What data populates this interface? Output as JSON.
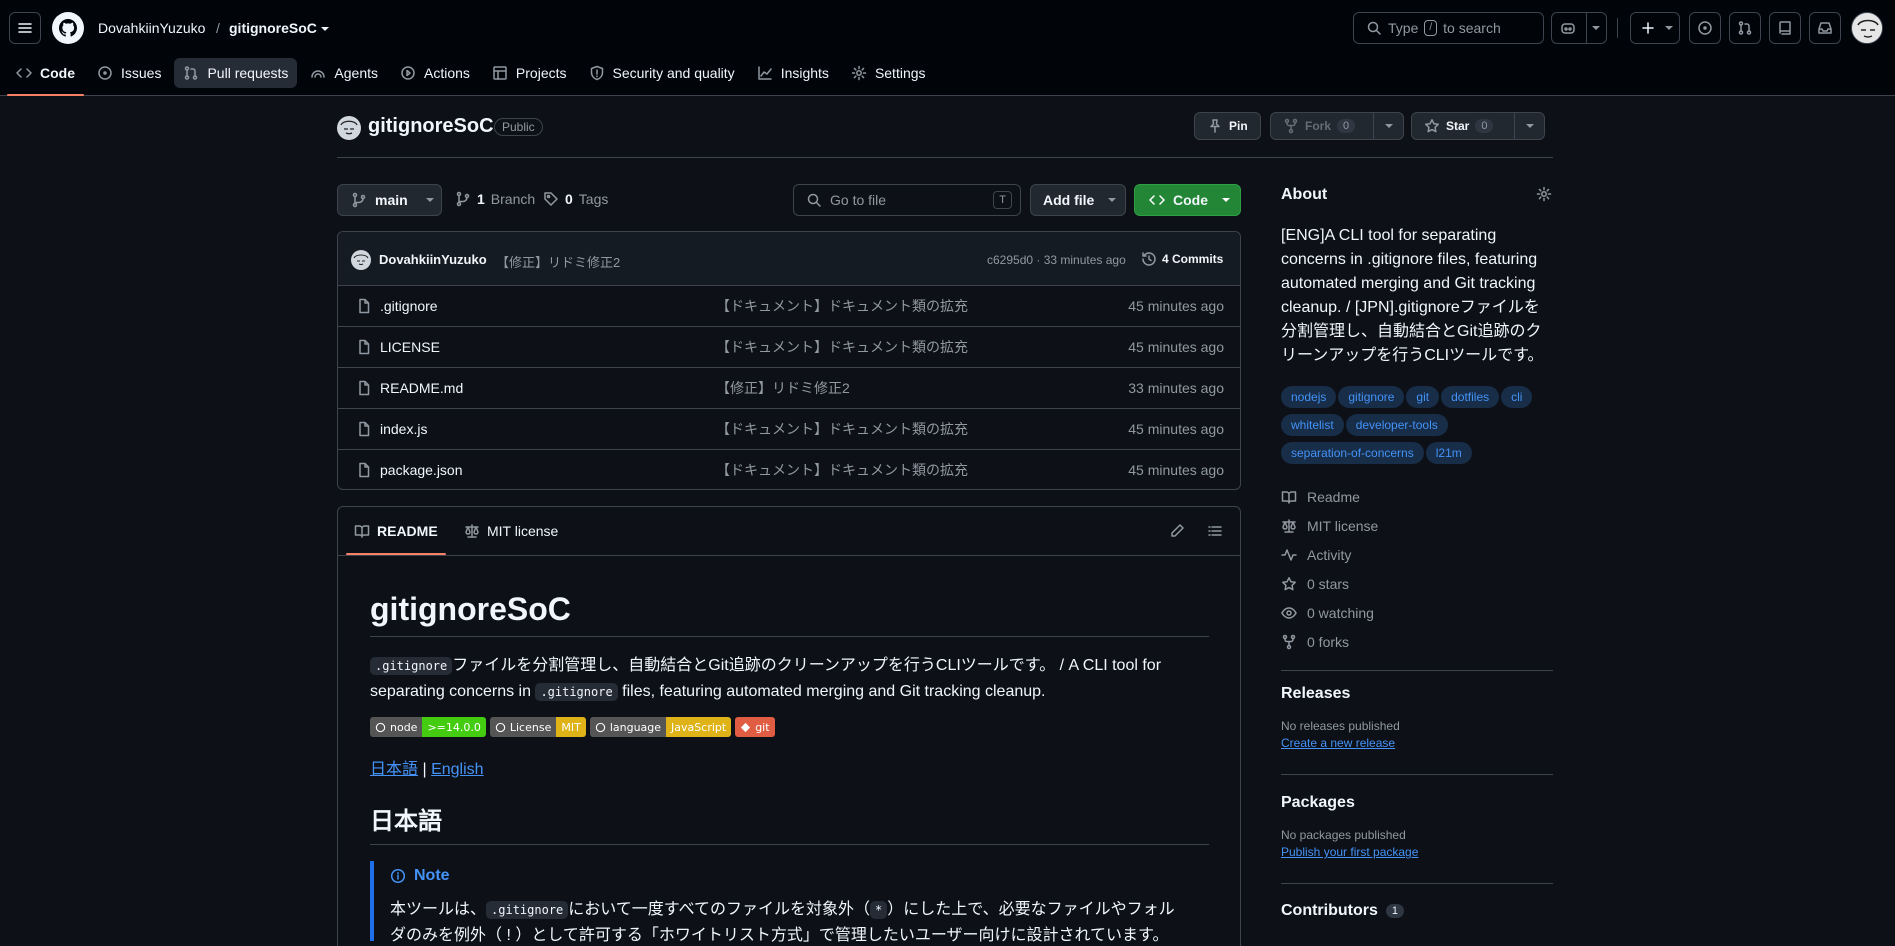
{
  "header": {
    "owner": "DovahkiinYuzuko",
    "separator": "/",
    "repo": "gitignoreSoC",
    "search_pre": "Type",
    "search_key": "/",
    "search_post": "to search"
  },
  "nav": [
    {
      "label": "Code",
      "icon": "code-icon"
    },
    {
      "label": "Issues",
      "icon": "issue-icon"
    },
    {
      "label": "Pull requests",
      "icon": "pull-request-icon"
    },
    {
      "label": "Agents",
      "icon": "agent-icon"
    },
    {
      "label": "Actions",
      "icon": "play-icon"
    },
    {
      "label": "Projects",
      "icon": "table-icon"
    },
    {
      "label": "Security and quality",
      "icon": "shield-icon"
    },
    {
      "label": "Insights",
      "icon": "graph-icon"
    },
    {
      "label": "Settings",
      "icon": "gear-icon"
    }
  ],
  "repo": {
    "name": "gitignoreSoC",
    "visibility": "Public",
    "pin": "Pin",
    "fork": "Fork",
    "fork_count": "0",
    "star": "Star",
    "star_count": "0"
  },
  "toolbar": {
    "branch": "main",
    "branches_count": "1",
    "branches_label": "Branch",
    "tags_count": "0",
    "tags_label": "Tags",
    "goto_placeholder": "Go to file",
    "goto_key": "T",
    "add_file": "Add file",
    "code": "Code"
  },
  "commit": {
    "author": "DovahkiinYuzuko",
    "message": "【修正】リドミ修正2",
    "meta": "c6295d0 · 33 minutes ago",
    "commits": "4 Commits"
  },
  "files": [
    {
      "name": ".gitignore",
      "message": "【ドキュメント】ドキュメント類の拡充",
      "age": "45 minutes ago"
    },
    {
      "name": "LICENSE",
      "message": "【ドキュメント】ドキュメント類の拡充",
      "age": "45 minutes ago"
    },
    {
      "name": "README.md",
      "message": "【修正】リドミ修正2",
      "age": "33 minutes ago"
    },
    {
      "name": "index.js",
      "message": "【ドキュメント】ドキュメント類の拡充",
      "age": "45 minutes ago"
    },
    {
      "name": "package.json",
      "message": "【ドキュメント】ドキュメント類の拡充",
      "age": "45 minutes ago"
    }
  ],
  "readme": {
    "tab_readme": "README",
    "tab_license": "MIT license",
    "title": "gitignoreSoC",
    "code_gitignore": ".gitignore",
    "para_jp": "ファイルを分割管理し、自動結合とGit追跡のクリーンアップを行うCLIツールです。 / A CLI tool for",
    "para_en_pre": "separating concerns in",
    "para_en_post": "files, featuring automated merging and Git tracking cleanup.",
    "badges": [
      {
        "left": "node",
        "right": ">=14.0.0",
        "color": "#4c1"
      },
      {
        "left": "License",
        "right": "MIT",
        "color": "#dfb317"
      },
      {
        "left": "language",
        "right": "JavaScript",
        "color": "#dfb317"
      },
      {
        "left": "",
        "right": "git",
        "color": "#e05d44"
      }
    ],
    "lang_jp": "日本語",
    "lang_sep": "|",
    "lang_en": "English",
    "h2": "日本語",
    "note_title": "Note",
    "note_pre": "本ツールは、",
    "note_mid": "において一度すべてのファイルを対象外（",
    "note_star": "*",
    "note_post": "）にした上で、必要なファイルやフォル",
    "note_line2": "ダのみを例外（ ! ）として許可する「ホワイトリスト方式」で管理したいユーザー向けに設計されています。"
  },
  "about": {
    "heading": "About",
    "description": "[ENG]A CLI tool for separating concerns in .gitignore files, featuring automated merging and Git tracking cleanup. / [JPN].gitignoreファイルを分割管理し、自動結合とGit追跡のクリーンアップを行うCLIツールです。",
    "topics": [
      "nodejs",
      "gitignore",
      "git",
      "dotfiles",
      "cli",
      "whitelist",
      "developer-tools",
      "separation-of-concerns",
      "l21m"
    ],
    "links": [
      {
        "label": "Readme",
        "icon": "book-icon"
      },
      {
        "label": "MIT license",
        "icon": "law-icon"
      },
      {
        "label": "Activity",
        "icon": "pulse-icon"
      },
      {
        "label": "0 stars",
        "icon": "star-icon"
      },
      {
        "label": "0 watching",
        "icon": "eye-icon"
      },
      {
        "label": "0 forks",
        "icon": "fork-icon"
      }
    ]
  },
  "releases": {
    "heading": "Releases",
    "empty": "No releases published",
    "link": "Create a new release"
  },
  "packages": {
    "heading": "Packages",
    "empty": "No packages published",
    "link": "Publish your first package"
  },
  "contributors": {
    "heading": "Contributors",
    "count": "1"
  }
}
